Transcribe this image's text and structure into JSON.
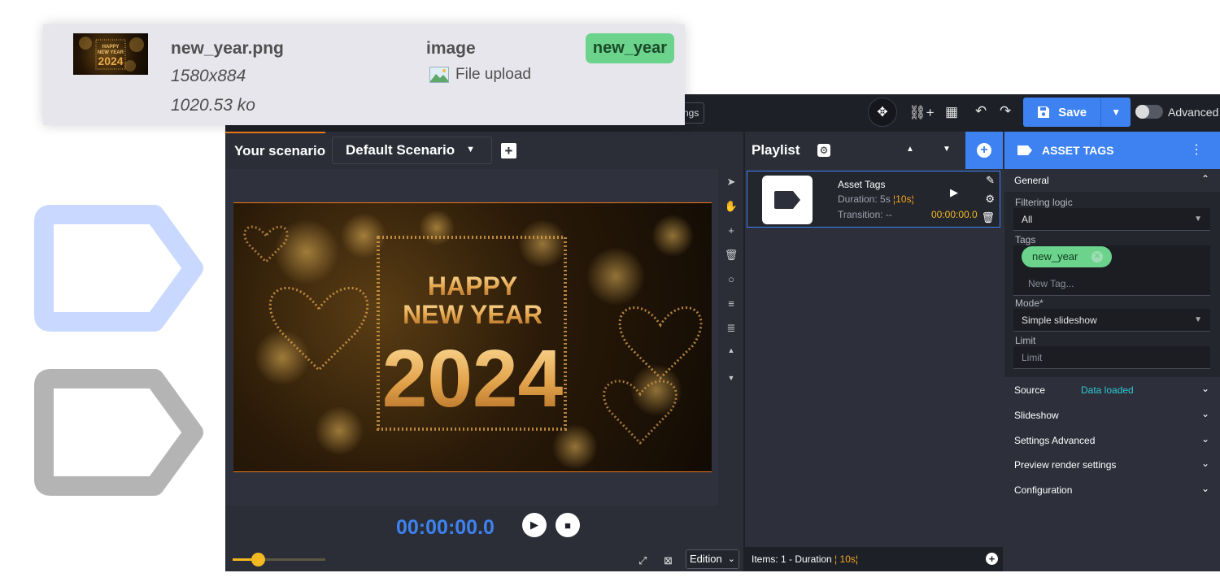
{
  "card": {
    "file_name": "new_year.png",
    "dimensions": "1580x884",
    "file_size": "1020.53 ko",
    "type": "image",
    "source": "File upload",
    "tag": "new_year"
  },
  "topbar": {
    "settings_chip": "ngs",
    "save_label": "Save",
    "advanced_label": "Advanced"
  },
  "scenario": {
    "title": "Your scenario",
    "selected": "Default Scenario",
    "timecode": "00:00:00.0",
    "mode": "Edition",
    "zoom_level": 0.28
  },
  "preview": {
    "line1": "HAPPY",
    "line2": "NEW YEAR",
    "year": "2024"
  },
  "playlist": {
    "title": "Playlist",
    "item": {
      "name": "Asset Tags",
      "duration_prefix": "Duration: 5s",
      "duration_alt": "10s",
      "transition": "Transition: --",
      "time": "00:00:00.0"
    },
    "footer_prefix": "Items: 1 - Duration",
    "footer_duration": "10s"
  },
  "props": {
    "title": "ASSET TAGS",
    "general_label": "General",
    "filtering_label": "Filtering logic",
    "filtering_value": "All",
    "tags_label": "Tags",
    "tag_value": "new_year",
    "new_tag_placeholder": "New Tag...",
    "mode_label": "Mode*",
    "mode_value": "Simple slideshow",
    "limit_label": "Limit",
    "limit_placeholder": "Limit",
    "sections": [
      {
        "label": "Source",
        "status": "Data loaded"
      },
      {
        "label": "Slideshow"
      },
      {
        "label": "Settings Advanced"
      },
      {
        "label": "Preview render settings"
      },
      {
        "label": "Configuration"
      }
    ]
  },
  "colors": {
    "accent": "#3d82f0",
    "tag_green": "#6bd38c",
    "timeline_orange": "#e87a1d",
    "time_yellow": "#f3b922"
  }
}
